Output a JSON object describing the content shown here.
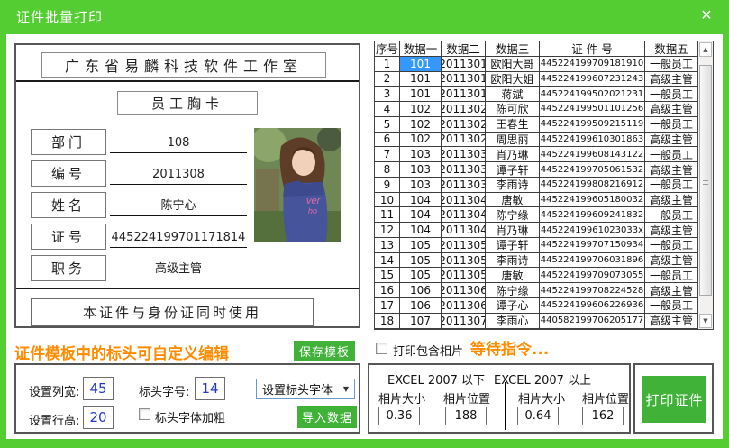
{
  "window": {
    "title": "证件批量打印",
    "close_icon": "✕"
  },
  "card": {
    "company": "广东省易麟科技软件工作室",
    "card_type": "员工胸卡",
    "fields": [
      {
        "label": "部门",
        "value": "108"
      },
      {
        "label": "编号",
        "value": "2011308"
      },
      {
        "label": "姓名",
        "value": "陈宁心"
      },
      {
        "label": "证号",
        "value": "445224199701171814"
      },
      {
        "label": "职务",
        "value": "高级主管"
      }
    ],
    "footer": "本证件与身份证同时使用",
    "photo": "portrait-photo-of-employee"
  },
  "table": {
    "headers": [
      "序号",
      "数据一",
      "数据二",
      "数据三",
      "证 件 号",
      "数据五"
    ],
    "rows": [
      [
        "1",
        "101",
        "2011301",
        "欧阳大哥",
        "445224199709181910",
        "一般员工"
      ],
      [
        "2",
        "101",
        "2011301",
        "欧阳大姐",
        "445224199607231243",
        "高级主管"
      ],
      [
        "3",
        "101",
        "2011301",
        "蒋斌",
        "445224199502021231",
        "一般员工"
      ],
      [
        "4",
        "102",
        "2011302",
        "陈可欣",
        "445224199501101256",
        "高级主管"
      ],
      [
        "5",
        "102",
        "2011302",
        "王春生",
        "445224199509215119",
        "一般员工"
      ],
      [
        "6",
        "102",
        "2011302",
        "周思丽",
        "445224199610301863",
        "高级主管"
      ],
      [
        "7",
        "103",
        "2011303",
        "肖乃琳",
        "445224199608143122",
        "一般员工"
      ],
      [
        "8",
        "103",
        "2011303",
        "谭子轩",
        "445224199705061532",
        "高级主管"
      ],
      [
        "9",
        "103",
        "2011303",
        "李雨诗",
        "445224199808216912",
        "一般员工"
      ],
      [
        "10",
        "104",
        "2011304",
        "唐敏",
        "445224199605180032",
        "高级主管"
      ],
      [
        "11",
        "104",
        "2011304",
        "陈宁缘",
        "445224199609241832",
        "一般员工"
      ],
      [
        "12",
        "104",
        "2011304",
        "肖乃琳",
        "44522419961023033x",
        "高级主管"
      ],
      [
        "13",
        "105",
        "2011305",
        "谭子轩",
        "445224199707150934",
        "一般员工"
      ],
      [
        "14",
        "105",
        "2011305",
        "李雨诗",
        "445224199706031896",
        "高级主管"
      ],
      [
        "15",
        "105",
        "2011305",
        "唐敏",
        "445224199709073055",
        "一般员工"
      ],
      [
        "16",
        "106",
        "2011306",
        "陈宁缘",
        "445224199708224528",
        "高级主管"
      ],
      [
        "17",
        "106",
        "2011306",
        "谭子心",
        "445224199606226936",
        "一般员工"
      ],
      [
        "18",
        "107",
        "2011307",
        "李雨心",
        "440582199706205177",
        "高级主管"
      ]
    ],
    "selected_cell": {
      "row": 0,
      "col": 1
    },
    "scrollbar": {
      "up_icon": "▲",
      "down_icon": "▼"
    }
  },
  "template_section": {
    "hint": "证件模板中的标头可自定义编辑",
    "save_button": "保存模板",
    "col_width_label": "设置列宽:",
    "col_width_value": "45",
    "header_fontsize_label": "标头字号:",
    "header_fontsize_value": "14",
    "row_height_label": "设置行高:",
    "row_height_value": "20",
    "header_bold_label": "标头字体加粗",
    "header_bold_checked": false,
    "font_select_value": "设置标头字体",
    "font_select_arrow": "▼",
    "import_button": "导入数据"
  },
  "print_section": {
    "include_photo_label": "打印包含相片",
    "include_photo_checked": false,
    "status_text": "等待指令...",
    "excel_below_header": "EXCEL 2007 以下",
    "excel_above_header": "EXCEL 2007 以上",
    "photo_size_label": "相片大小",
    "photo_pos_label": "相片位置",
    "below_photo_size": "0.36",
    "below_photo_pos": "188",
    "above_photo_size": "0.64",
    "above_photo_pos": "162",
    "print_button": "打印证件"
  },
  "colors": {
    "window_green": "#53cd31",
    "button_green": "#3fb237",
    "accent_orange": "#ff8c00",
    "selection_blue": "#3399ff",
    "input_value_blue": "#2336c8"
  }
}
